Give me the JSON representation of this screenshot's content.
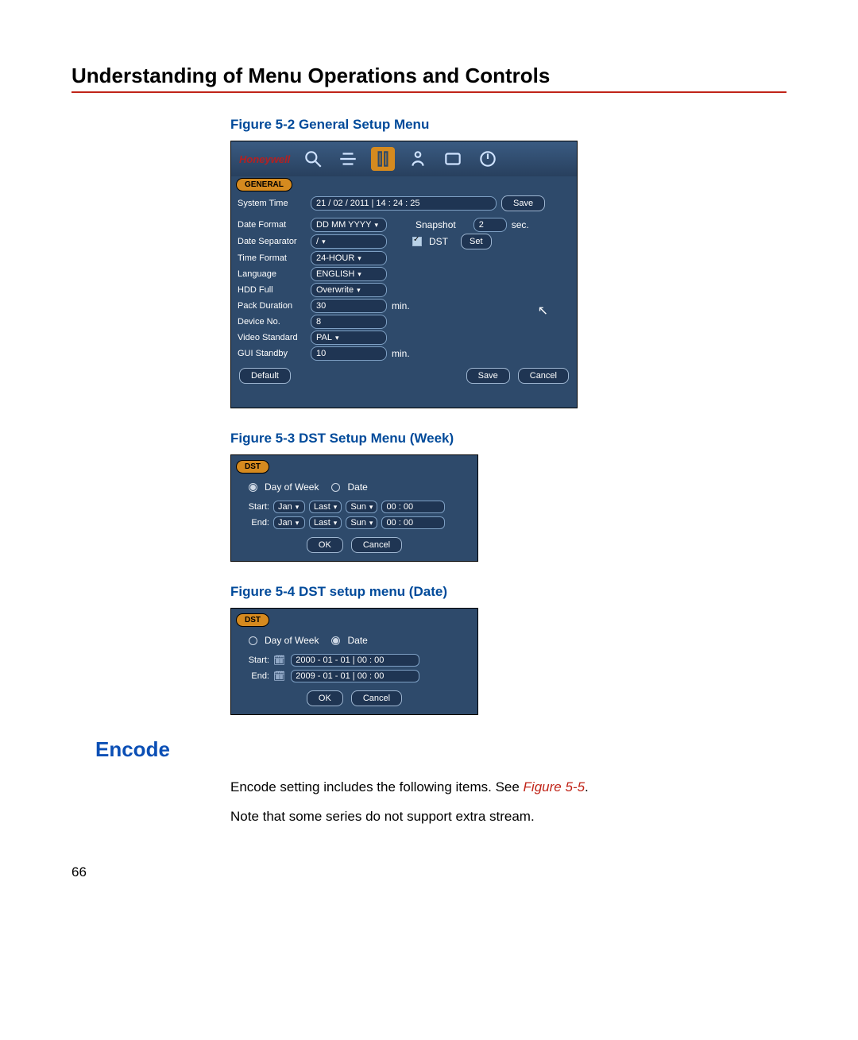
{
  "page": {
    "section_title": "Understanding of Menu Operations and Controls",
    "page_number": "66"
  },
  "fig1": {
    "caption": "Figure 5-2 General Setup Menu",
    "brand": "Honeywell",
    "tab": "GENERAL",
    "labels": {
      "system_time": "System Time",
      "date_format": "Date Format",
      "date_separator": "Date Separator",
      "time_format": "Time Format",
      "language": "Language",
      "hdd_full": "HDD Full",
      "pack_duration": "Pack Duration",
      "device_no": "Device No.",
      "video_standard": "Video Standard",
      "gui_standby": "GUI Standby",
      "snapshot": "Snapshot",
      "dst": "DST",
      "sec": "sec.",
      "min": "min."
    },
    "values": {
      "system_time": "21 / 02 / 2011   | 14 : 24 : 25",
      "date_format": "DD MM YYYY",
      "date_separator": "/",
      "time_format": "24-HOUR",
      "language": "ENGLISH",
      "hdd_full": "Overwrite",
      "pack_duration": "30",
      "device_no": "8",
      "video_standard": "PAL",
      "gui_standby": "10",
      "snapshot": "2"
    },
    "buttons": {
      "save_top": "Save",
      "set": "Set",
      "default": "Default",
      "save": "Save",
      "cancel": "Cancel"
    }
  },
  "fig2": {
    "caption": "Figure 5-3 DST Setup Menu (Week)",
    "tab": "DST",
    "radio_dow": "Day of Week",
    "radio_date": "Date",
    "start_label": "Start:",
    "end_label": "End:",
    "start": {
      "month": "Jan",
      "week": "Last",
      "day": "Sun",
      "time": "00  : 00"
    },
    "end": {
      "month": "Jan",
      "week": "Last",
      "day": "Sun",
      "time": "00  : 00"
    },
    "ok": "OK",
    "cancel": "Cancel"
  },
  "fig3": {
    "caption": "Figure 5-4 DST setup menu (Date)",
    "tab": "DST",
    "radio_dow": "Day of Week",
    "radio_date": "Date",
    "start_label": "Start:",
    "end_label": "End:",
    "start_val": "2000  - 01 - 01  | 00 : 00",
    "end_val": "2009  - 01 - 01  | 00 : 00",
    "ok": "OK",
    "cancel": "Cancel"
  },
  "encode": {
    "heading": "Encode",
    "line1a": "Encode setting includes the following items. See ",
    "line1b": "Figure 5-5",
    "line1c": ".",
    "line2": "Note that some series do not support extra stream."
  }
}
